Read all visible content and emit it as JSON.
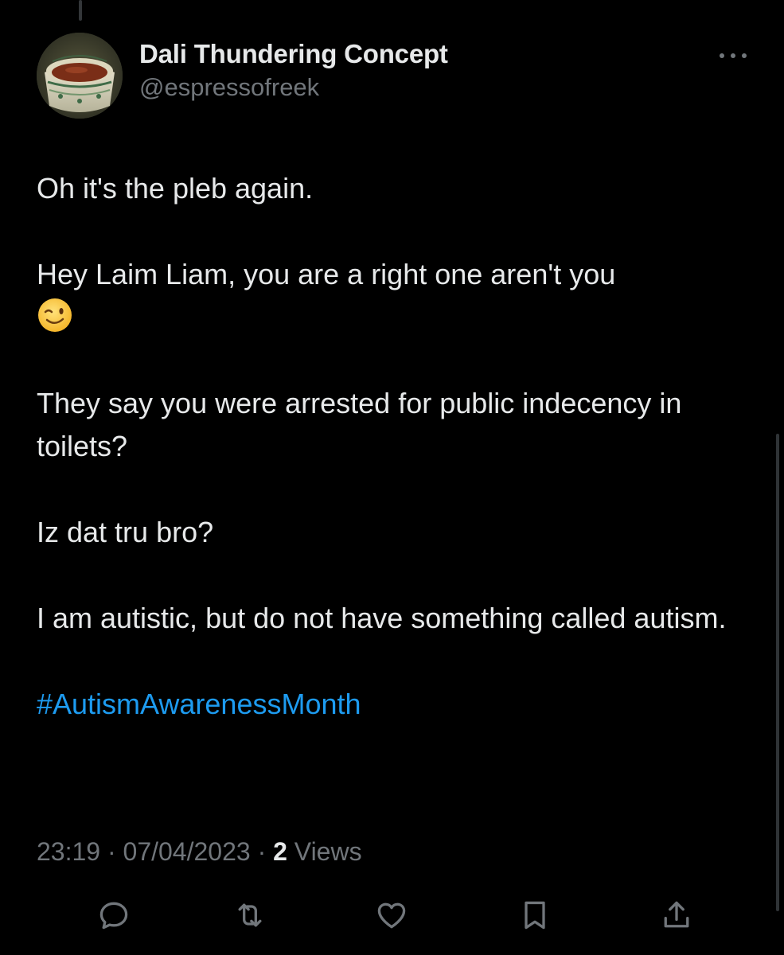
{
  "tweet": {
    "author": {
      "display_name": "Dali Thundering Concept",
      "handle": "@espressofreek"
    },
    "paragraphs": [
      "Oh it's the pleb again.",
      "Hey Laim Liam, you are a right one aren't you",
      "They say you were arrested for public indecency in toilets?",
      "Iz dat tru bro?",
      "I am autistic, but do not have something called autism."
    ],
    "emoji": "wink-emoji",
    "hashtag": "#AutismAwarenessMonth",
    "time": "23:19",
    "date": "07/04/2023",
    "separator": "·",
    "views_count": "2",
    "views_label": "Views"
  },
  "actions": [
    {
      "name": "reply",
      "icon": "reply-icon"
    },
    {
      "name": "retweet",
      "icon": "retweet-icon"
    },
    {
      "name": "like",
      "icon": "heart-icon"
    },
    {
      "name": "bookmark",
      "icon": "bookmark-icon"
    },
    {
      "name": "share",
      "icon": "share-icon"
    }
  ],
  "colors": {
    "background": "#000000",
    "text_primary": "#e7e9ea",
    "text_secondary": "#71767b",
    "link": "#1d9bf0"
  }
}
